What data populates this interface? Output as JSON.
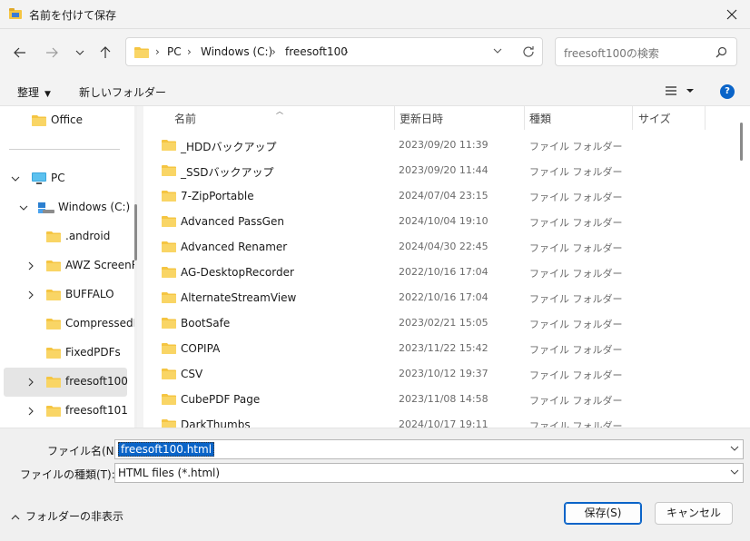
{
  "window": {
    "title": "名前を付けて保存",
    "icons": {
      "app": "save-app-icon",
      "close": "close-icon"
    }
  },
  "navigation": {
    "address": {
      "crumbs": [
        "PC",
        "Windows (C:)",
        "freesoft100"
      ]
    },
    "search": {
      "placeholder": "freesoft100の検索"
    }
  },
  "commandbar": {
    "organize": "整理",
    "new_folder": "新しいフォルダー"
  },
  "tree": {
    "quick": [
      {
        "label": "Office"
      }
    ],
    "pc": {
      "label": "PC"
    },
    "drive": {
      "label": "Windows (C:)"
    },
    "folders": [
      {
        "label": ".android",
        "expandable": false
      },
      {
        "label": "AWZ ScreenR",
        "expandable": true
      },
      {
        "label": "BUFFALO",
        "expandable": true
      },
      {
        "label": "CompressedPD",
        "expandable": false
      },
      {
        "label": "FixedPDFs",
        "expandable": false
      },
      {
        "label": "freesoft100",
        "expandable": true,
        "selected": true
      },
      {
        "label": "freesoft101",
        "expandable": true
      }
    ]
  },
  "list": {
    "columns": {
      "name": "名前",
      "date": "更新日時",
      "type": "種類",
      "size": "サイズ"
    },
    "rows": [
      {
        "name": "_HDDバックアップ",
        "date": "2023/09/20 11:39",
        "type": "ファイル フォルダー"
      },
      {
        "name": "_SSDバックアップ",
        "date": "2023/09/20 11:44",
        "type": "ファイル フォルダー"
      },
      {
        "name": "7-ZipPortable",
        "date": "2024/07/04 23:15",
        "type": "ファイル フォルダー"
      },
      {
        "name": "Advanced PassGen",
        "date": "2024/10/04 19:10",
        "type": "ファイル フォルダー"
      },
      {
        "name": "Advanced Renamer",
        "date": "2024/04/30 22:45",
        "type": "ファイル フォルダー"
      },
      {
        "name": "AG-DesktopRecorder",
        "date": "2022/10/16 17:04",
        "type": "ファイル フォルダー"
      },
      {
        "name": "AlternateStreamView",
        "date": "2022/10/16 17:04",
        "type": "ファイル フォルダー"
      },
      {
        "name": "BootSafe",
        "date": "2023/02/21 15:05",
        "type": "ファイル フォルダー"
      },
      {
        "name": "COPIPA",
        "date": "2023/11/22 15:42",
        "type": "ファイル フォルダー"
      },
      {
        "name": "CSV",
        "date": "2023/10/12 19:37",
        "type": "ファイル フォルダー"
      },
      {
        "name": "CubePDF Page",
        "date": "2023/11/08 14:58",
        "type": "ファイル フォルダー"
      },
      {
        "name": "DarkThumbs",
        "date": "2024/10/17 19:11",
        "type": "ファイル フォルダー"
      }
    ]
  },
  "form": {
    "filename_label": "ファイル名(N):",
    "filename_value": "freesoft100.html",
    "filetype_label": "ファイルの種類(T):",
    "filetype_value": "HTML files (*.html)"
  },
  "footer": {
    "toggle_folders": "フォルダーの非表示",
    "save": "保存(S)",
    "cancel": "キャンセル"
  },
  "colors": {
    "accent": "#0a64c8",
    "folder": "#f5c542",
    "selection": "#e5e5e5"
  }
}
